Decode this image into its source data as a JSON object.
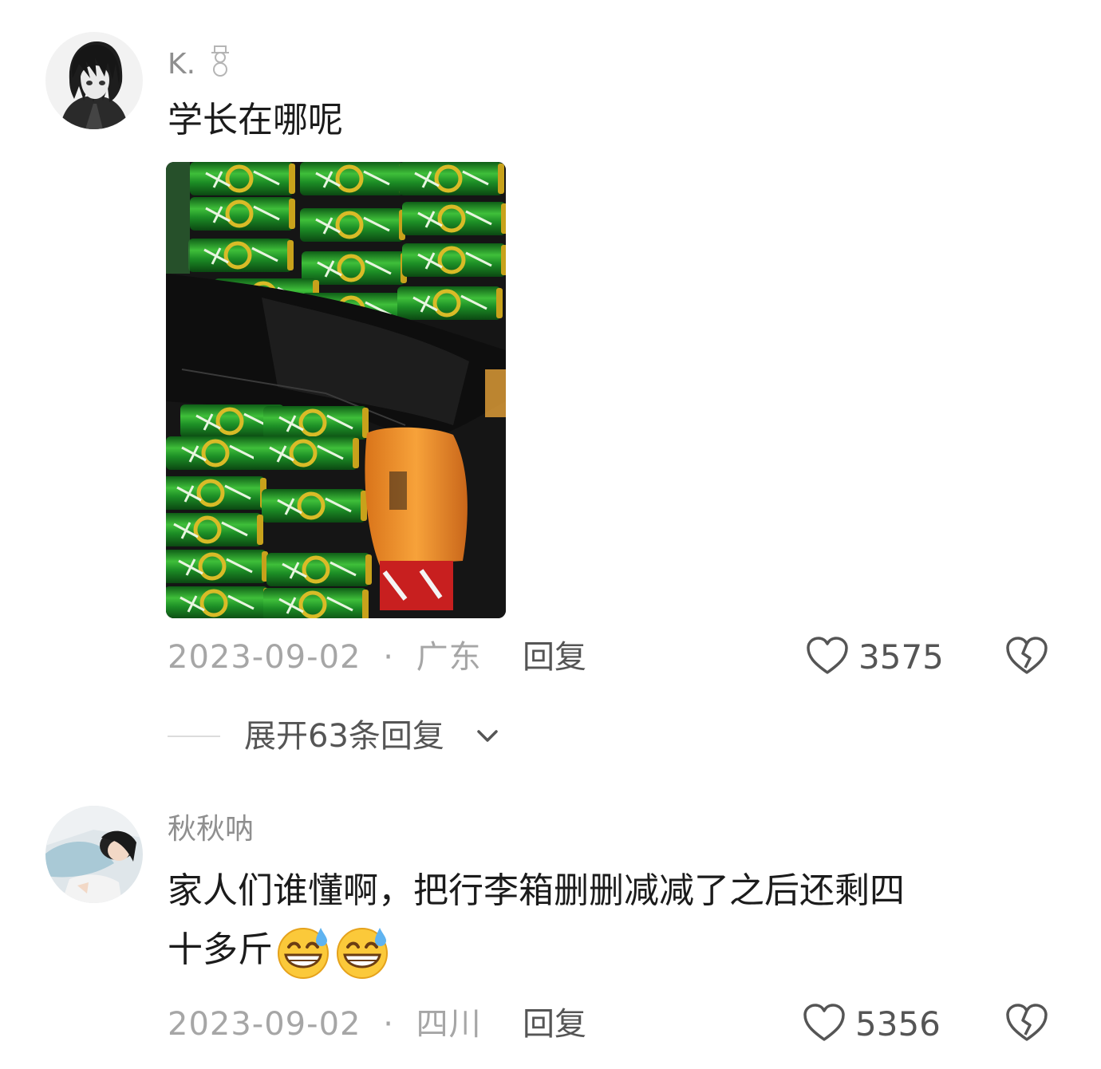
{
  "comments": [
    {
      "username": "K.",
      "username_badge_icon": "snowman-icon",
      "text": "学长在哪呢",
      "has_image": true,
      "date": "2023-09-02",
      "separator": "·",
      "location": "广东",
      "reply_label": "回复",
      "likes": "3575",
      "expand_label": "展开63条回复"
    },
    {
      "username": "秋秋呐",
      "text_line1": "家人们谁懂啊，把行李箱删删减减了之后还剩四",
      "text_line2": "十多斤",
      "emojis": [
        "sweat-grin-emoji",
        "sweat-grin-emoji"
      ],
      "date": "2023-09-02",
      "separator": "·",
      "location": "四川",
      "reply_label": "回复",
      "likes": "5356"
    }
  ],
  "colors": {
    "username": "#8f8f8f",
    "meta": "#a6a6a6",
    "action": "#555555",
    "can_green": "#1e8a2a",
    "can_gold": "#d4b01c",
    "bag_orange": "#f0962a"
  }
}
